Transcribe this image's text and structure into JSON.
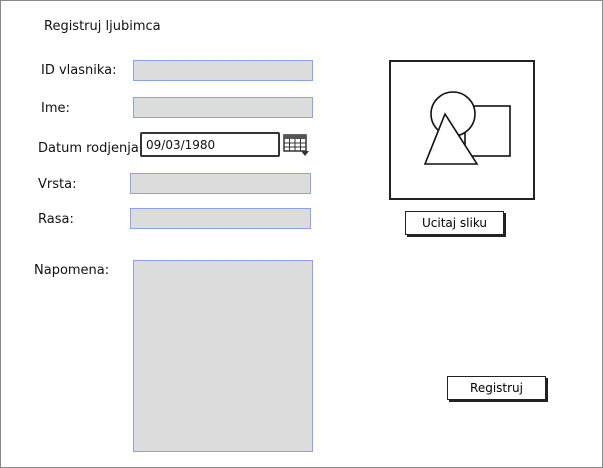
{
  "form": {
    "title": "Registruj ljubimca",
    "owner_id_label": "ID vlasnika:",
    "name_label": "Ime:",
    "birth_date_label": "Datum rodjenja:",
    "birth_date_value": "09/03/1980",
    "species_label": "Vrsta:",
    "breed_label": "Rasa:",
    "note_label": "Napomena:"
  },
  "image_panel": {
    "load_button_label": "Ucitaj sliku"
  },
  "actions": {
    "register_label": "Registruj"
  },
  "icons": {
    "calendar": "calendar-icon",
    "image_placeholder": "image-placeholder-icon"
  }
}
